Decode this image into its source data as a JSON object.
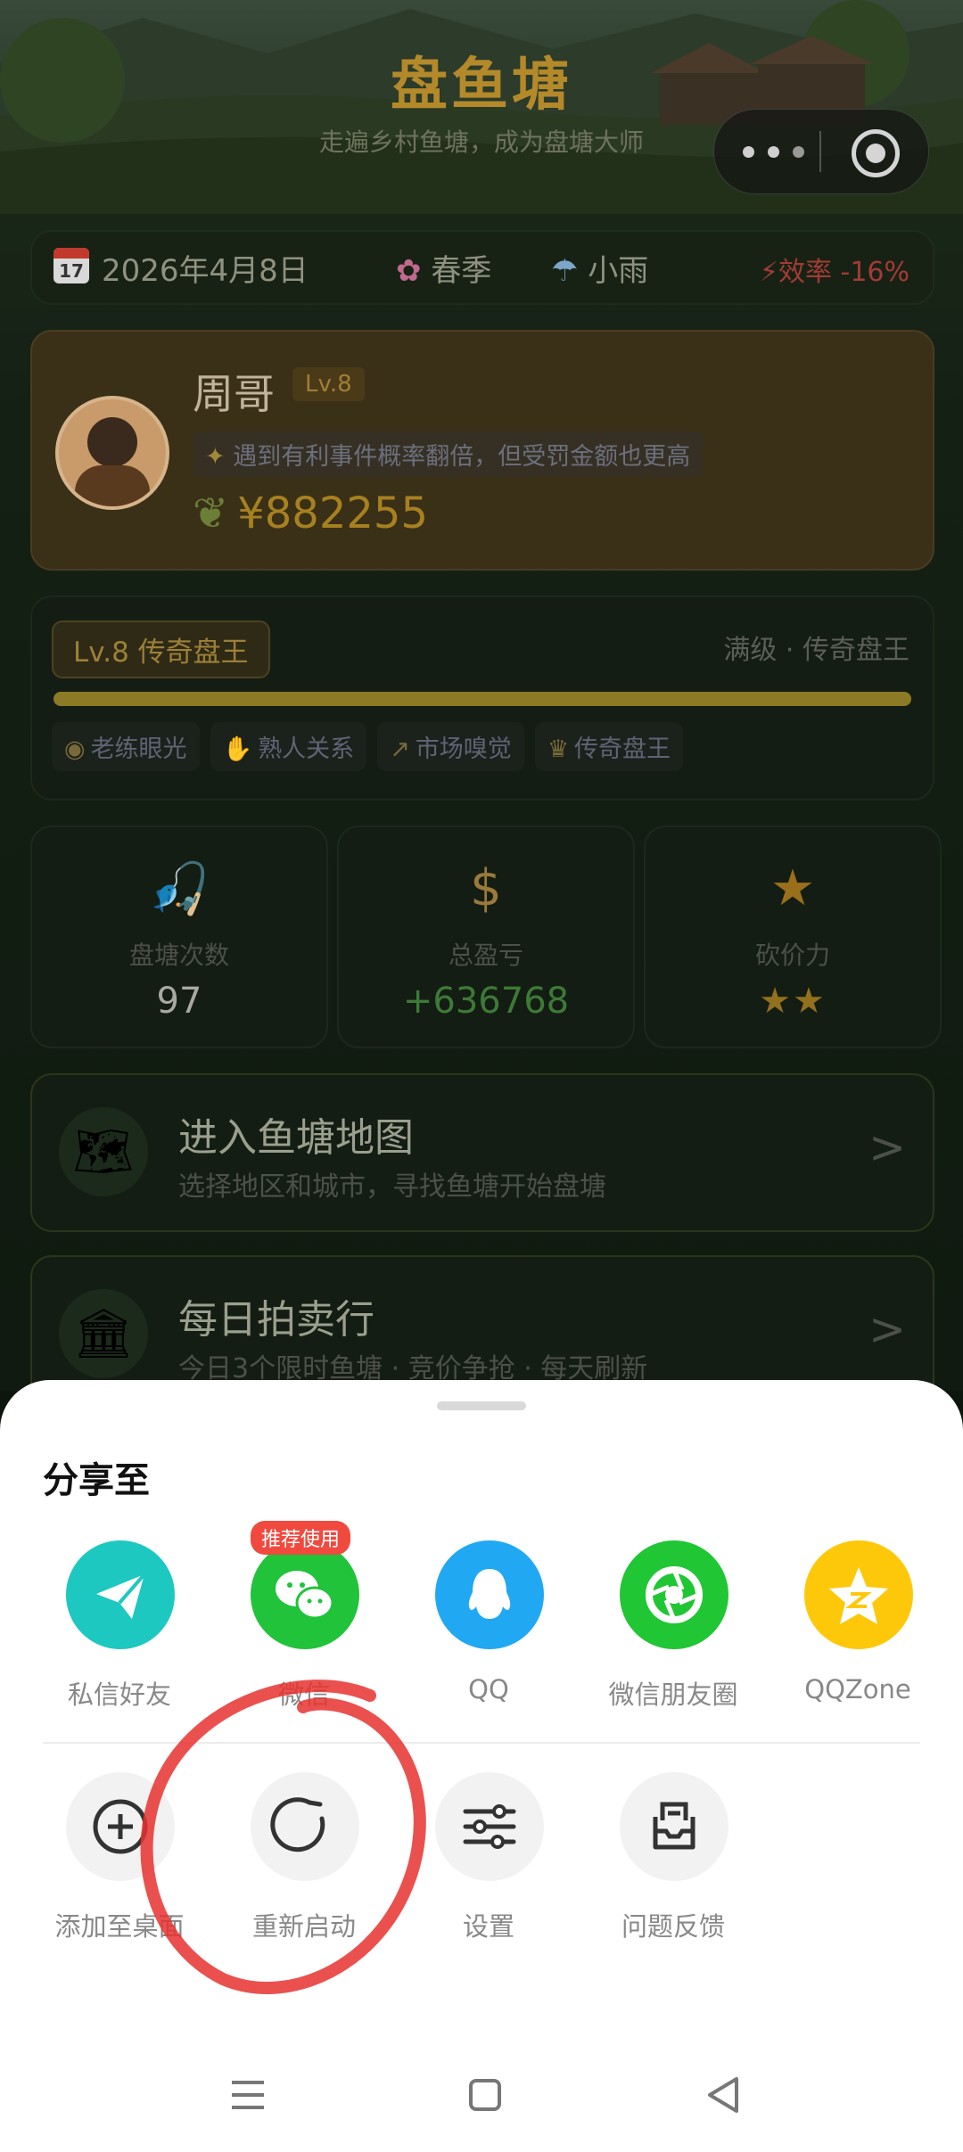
{
  "game": {
    "title": "盘鱼塘",
    "subtitle": "走遍乡村鱼塘，成为盘塘大师"
  },
  "status_bar": {
    "calendar_day": "17",
    "date": "2026年4月8日",
    "season": "春季",
    "weather": "小雨",
    "efficiency": "效率 -16%"
  },
  "profile": {
    "name": "周哥",
    "level_tag": "Lv.8",
    "trait": "遇到有利事件概率翻倍，但受罚金额也更高",
    "money": "¥882255"
  },
  "level_card": {
    "badge": "Lv.8  传奇盘王",
    "right_text": "满级 · 传奇盘王",
    "progress": 1.0,
    "skills": [
      "老练眼光",
      "熟人关系",
      "市场嗅觉",
      "传奇盘王"
    ]
  },
  "stats": [
    {
      "label": "盘塘次数",
      "value": "97",
      "icon": "fishing-icon"
    },
    {
      "label": "总盈亏",
      "value": "+636768",
      "icon": "money-bag-icon"
    },
    {
      "label": "砍价力",
      "value": "★★",
      "icon": "star-icon"
    }
  ],
  "menu": [
    {
      "title": "进入鱼塘地图",
      "subtitle": "选择地区和城市，寻找鱼塘开始盘塘",
      "icon": "map-icon"
    },
    {
      "title": "每日拍卖行",
      "subtitle": "今日3个限时鱼塘 · 竞价争抢 · 每天刷新",
      "icon": "bank-icon"
    }
  ],
  "share_sheet": {
    "title": "分享至",
    "share_targets": [
      {
        "label": "私信好友",
        "icon": "paper-plane-icon",
        "color": "#1dc8c0"
      },
      {
        "label": "微信",
        "icon": "wechat-icon",
        "color": "#20c33a",
        "badge": "推荐使用"
      },
      {
        "label": "QQ",
        "icon": "qq-penguin-icon",
        "color": "#21a8f2"
      },
      {
        "label": "微信朋友圈",
        "icon": "moments-shutter-icon",
        "color": "#21c635"
      },
      {
        "label": "QQZone",
        "icon": "qzone-star-icon",
        "color": "#fec80a"
      }
    ],
    "actions": [
      {
        "label": "添加至桌面",
        "icon": "add-circle-icon"
      },
      {
        "label": "重新启动",
        "icon": "restart-icon"
      },
      {
        "label": "设置",
        "icon": "sliders-icon"
      },
      {
        "label": "问题反馈",
        "icon": "feedback-icon"
      }
    ]
  },
  "colors": {
    "sheet_bg": "#ffffff",
    "annotation_red": "#e6332f",
    "page_bg": "#0c160d"
  }
}
